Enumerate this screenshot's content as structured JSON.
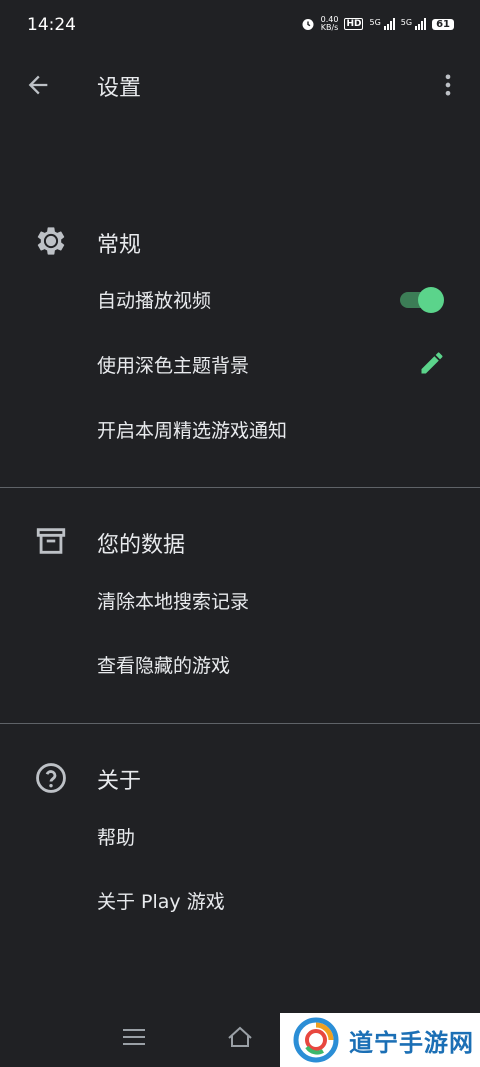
{
  "status_bar": {
    "time": "14:24",
    "speed_value": "0.40",
    "speed_unit": "KB/s",
    "hd_label": "HD",
    "signal1_label": "5G",
    "signal2_label": "5G",
    "battery": "61"
  },
  "app_bar": {
    "back_icon": "arrow-back-icon",
    "title": "设置",
    "more_icon": "more-vert-icon"
  },
  "sections": {
    "general": {
      "icon": "gear-icon",
      "title": "常规",
      "items": [
        {
          "label": "自动播放视频",
          "control": "toggle",
          "value": true
        },
        {
          "label": "使用深色主题背景",
          "control": "edit"
        },
        {
          "label": "开启本周精选游戏通知"
        }
      ]
    },
    "data": {
      "icon": "archive-icon",
      "title": "您的数据",
      "items": [
        {
          "label": "清除本地搜索记录"
        },
        {
          "label": "查看隐藏的游戏"
        }
      ]
    },
    "about": {
      "icon": "help-circle-icon",
      "title": "关于",
      "items": [
        {
          "label": "帮助"
        },
        {
          "label": "关于 Play 游戏"
        }
      ]
    }
  },
  "colors": {
    "background": "#202124",
    "accent_green": "#5bd48b",
    "divider": "#5f6368"
  },
  "watermark": {
    "text": "道宁手游网"
  }
}
